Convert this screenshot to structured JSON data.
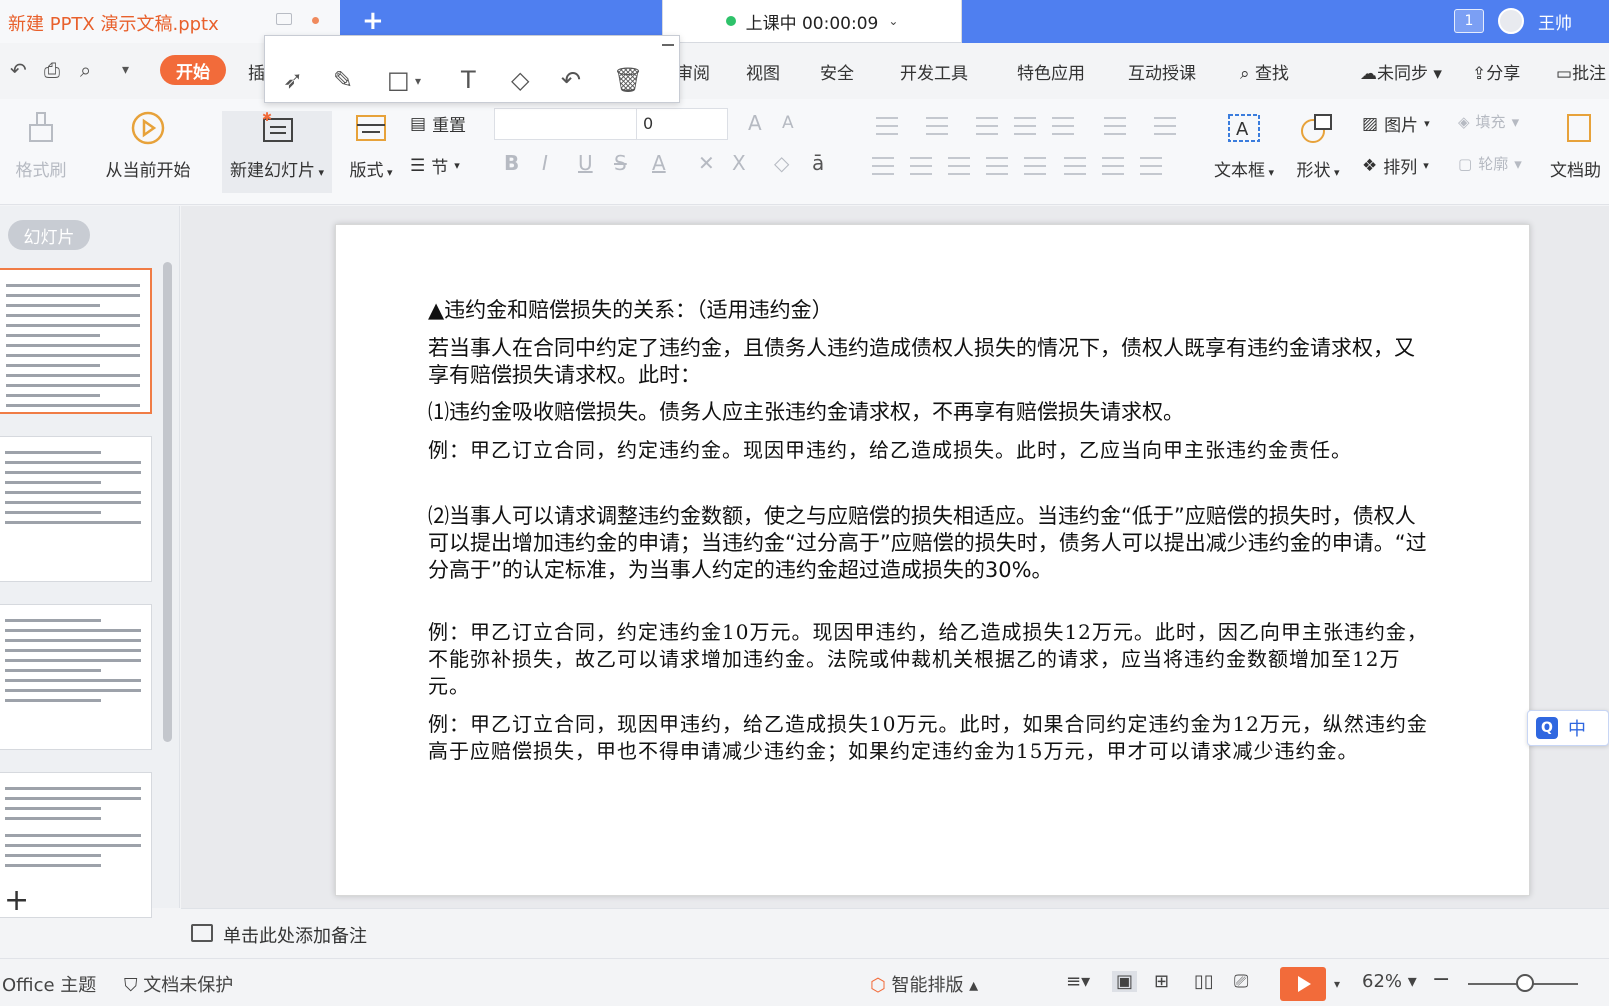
{
  "titlebar": {
    "doc_title": "新建 PPTX 演示文稿.pptx",
    "new_tab": "+",
    "class_status": "上课中 00:00:09",
    "badge": "1",
    "user_name": "王帅"
  },
  "quick_access": {
    "start_label": "开始",
    "partial_insert": "插"
  },
  "menu": {
    "items": [
      "审阅",
      "视图",
      "安全",
      "开发工具",
      "特色应用",
      "互动授课"
    ],
    "search": "查找",
    "sync": "未同步",
    "share": "分享",
    "batch": "批注"
  },
  "ribbon": {
    "format_painter": "格式刷",
    "from_current": "从当前开始",
    "new_slide": "新建幻灯片",
    "layout": "版式",
    "reset": "重置",
    "section": "节",
    "font_name": "",
    "font_size": "0",
    "textbox": "文本框",
    "shape": "形状",
    "picture": "图片",
    "arrange": "排列",
    "fill": "填充",
    "outline": "轮廓",
    "doc_assist": "文档助"
  },
  "left_panel": {
    "tab_label": "幻灯片"
  },
  "slide": {
    "heading": "▲违约金和赔偿损失的关系：（适用违约金）",
    "intro": "若当事人在合同中约定了违约金，且债务人违约造成债权人损失的情况下，债权人既享有违约金请求权，又享有赔偿损失请求权。此时：",
    "point1": "⑴违约金吸收赔偿损失。债务人应主张违约金请求权，不再享有赔偿损失请求权。",
    "example1": "例：甲乙订立合同，约定违约金。现因甲违约，给乙造成损失。此时，乙应当向甲主张违约金责任。",
    "point2": "⑵当事人可以请求调整违约金数额，使之与应赔偿的损失相适应。当违约金“低于”应赔偿的损失时，债权人可以提出增加违约金的申请；当违约金“过分高于”应赔偿的损失时，债务人可以提出减少违约金的申请。“过分高于”的认定标准，为当事人约定的违约金超过造成损失的30%。",
    "example2": "例：甲乙订立合同，约定违约金10万元。现因甲违约，给乙造成损失12万元。此时，因乙向甲主张违约金，不能弥补损失，故乙可以请求增加违约金。法院或仲裁机关根据乙的请求，应当将违约金数额增加至12万元。",
    "example3": "例：甲乙订立合同，现因甲违约，给乙造成损失10万元。此时，如果合同约定违约金为12万元，纵然违约金高于应赔偿损失，甲也不得申请减少违约金；如果约定违约金为15万元，甲才可以请求减少违约金。"
  },
  "ime": {
    "q": "Q",
    "mode": "中"
  },
  "notes": {
    "placeholder": "单击此处添加备注"
  },
  "statusbar": {
    "theme": "Office 主题",
    "protect": "文档未保护",
    "smart_layout": "智能排版",
    "zoom": "62%"
  },
  "colors": {
    "accent_orange": "#f26b3a",
    "title_blue": "#4f7ff0"
  }
}
